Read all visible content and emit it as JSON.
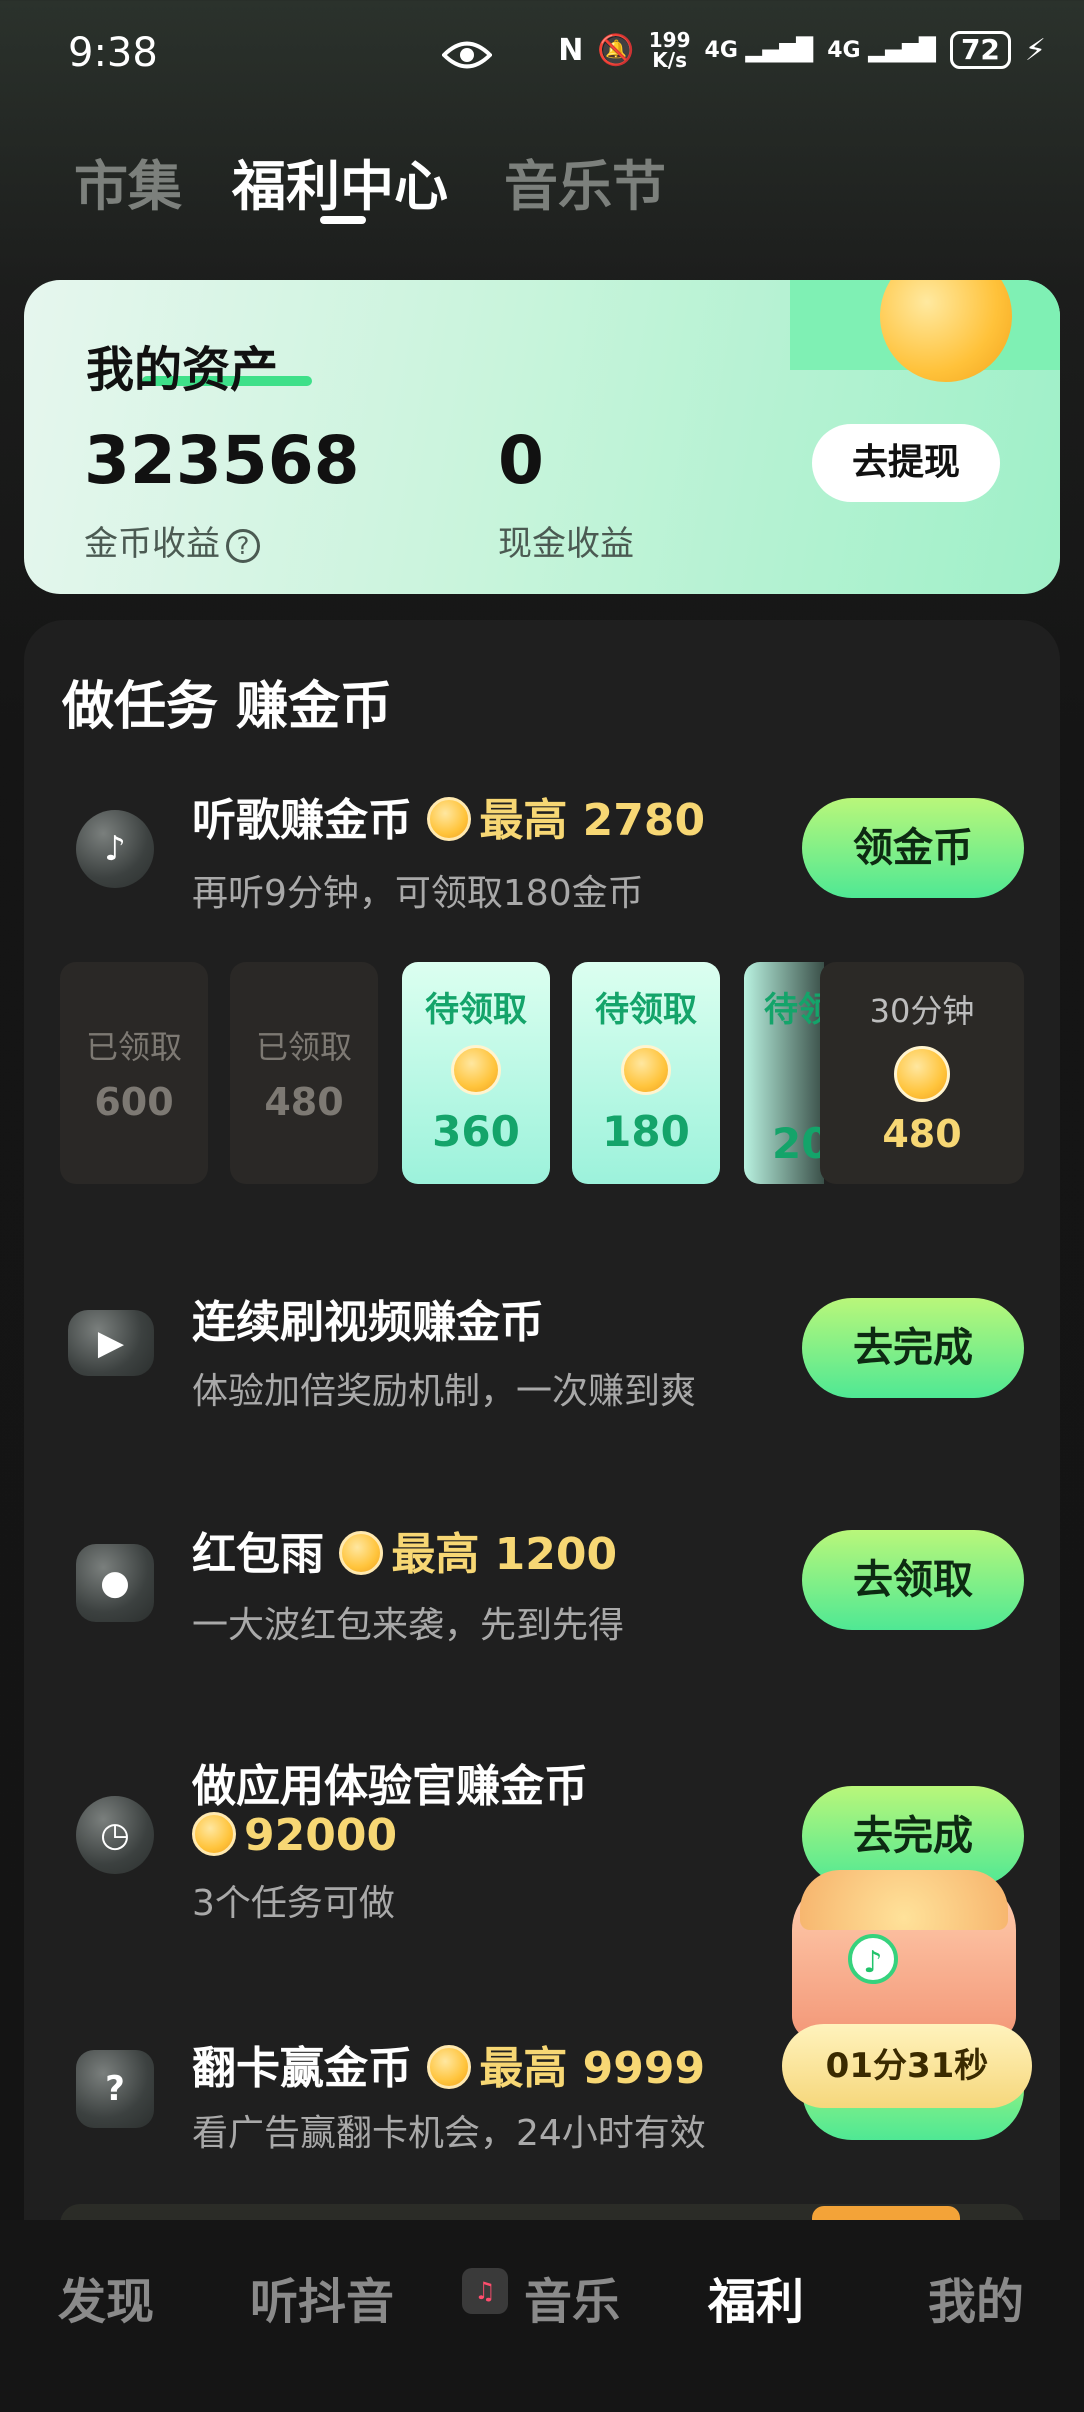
{
  "status_bar": {
    "time": "9:38",
    "net_speed_top": "199",
    "net_speed_bottom": "K/s",
    "signal1": "4G",
    "signal2": "4G",
    "battery": "72"
  },
  "top_tabs": [
    {
      "label": "市集"
    },
    {
      "label": "福利中心",
      "active": true
    },
    {
      "label": "音乐节"
    }
  ],
  "assets": {
    "title": "我的资产",
    "coins_value": "323568",
    "coins_label": "金币收益",
    "cash_value": "0",
    "cash_label": "现金收益",
    "withdraw_label": "去提现"
  },
  "tasks_title": "做任务 赚金币",
  "tasks": [
    {
      "title": "听歌赚金币",
      "highlight": "最高 2780",
      "subtitle": "再听9分钟，可领取180金币",
      "button": "领金币",
      "icon": "music-note-icon"
    },
    {
      "title": "连续刷视频赚金币",
      "highlight": "",
      "subtitle": "体验加倍奖励机制，一次赚到爽",
      "button": "去完成",
      "icon": "video-camera-icon"
    },
    {
      "title": "红包雨",
      "highlight": "最高 1200",
      "subtitle": "一大波红包来袭，先到先得",
      "button": "去领取",
      "icon": "red-envelope-icon"
    },
    {
      "title": "做应用体验官赚金币",
      "highlight": "92000",
      "subtitle": "3个任务可做",
      "button": "去完成",
      "icon": "clock-icon"
    },
    {
      "title": "翻卡赢金币",
      "highlight": "最高 9999",
      "subtitle": "看广告赢翻卡机会，24小时有效",
      "button": "",
      "icon": "question-card-icon"
    }
  ],
  "reward_slots": [
    {
      "status": "已领取",
      "value": "600"
    },
    {
      "status": "已领取",
      "value": "480"
    },
    {
      "status": "待领取",
      "value": "360"
    },
    {
      "status": "待领取",
      "value": "180"
    },
    {
      "status": "待领",
      "value": "20"
    }
  ],
  "reward_final": {
    "label": "30分钟",
    "value": "480"
  },
  "chest_timer": "01分31秒",
  "bottom_nav": [
    {
      "label": "发现"
    },
    {
      "label": "听抖音"
    },
    {
      "label": "音乐"
    },
    {
      "label": "福利",
      "active": true
    },
    {
      "label": "我的"
    }
  ]
}
